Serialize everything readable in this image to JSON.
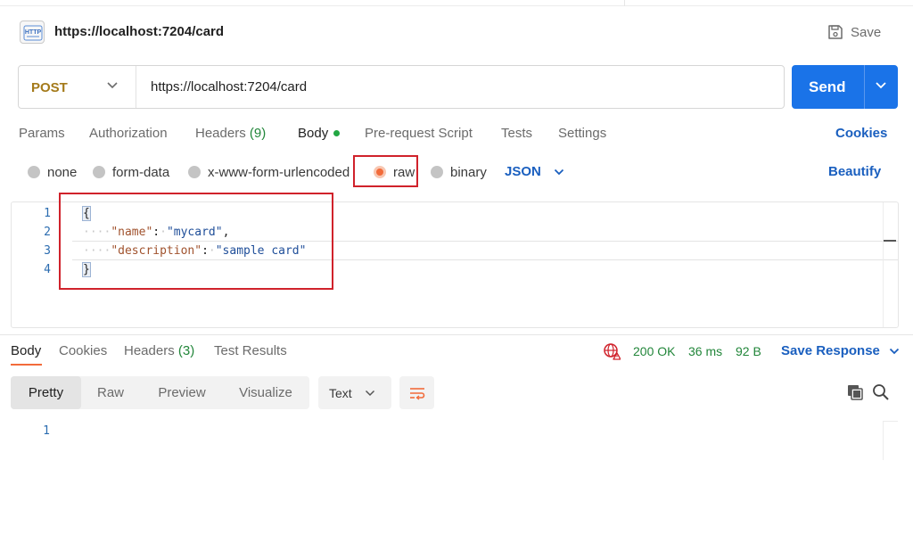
{
  "header": {
    "tab_title": "https://localhost:7204/card",
    "http_icon": "http-file-icon",
    "save_label": "Save"
  },
  "request": {
    "method": "POST",
    "url": "https://localhost:7204/card",
    "send_label": "Send"
  },
  "request_tabs": {
    "params": "Params",
    "authorization": "Authorization",
    "headers": "Headers",
    "headers_count": "(9)",
    "body": "Body",
    "prerequest": "Pre-request Script",
    "tests": "Tests",
    "settings": "Settings",
    "cookies": "Cookies"
  },
  "body_types": {
    "none": "none",
    "form_data": "form-data",
    "urlencoded": "x-www-form-urlencoded",
    "raw": "raw",
    "binary": "binary",
    "selected": "raw",
    "format": "JSON",
    "beautify": "Beautify"
  },
  "editor": {
    "line_numbers": [
      "1",
      "2",
      "3",
      "4"
    ],
    "open_brace": "{",
    "close_brace": "}",
    "indent": "····",
    "key1": "\"name\"",
    "value1": "\"mycard\"",
    "key2": "\"description\"",
    "value2": "\"sample card\""
  },
  "response_tabs": {
    "body": "Body",
    "cookies": "Cookies",
    "headers": "Headers",
    "headers_count": "(3)",
    "test_results": "Test Results"
  },
  "response_status": {
    "status": "200 OK",
    "time": "36 ms",
    "size": "92 B",
    "save_response": "Save Response"
  },
  "response_view": {
    "pretty": "Pretty",
    "raw": "Raw",
    "preview": "Preview",
    "visualize": "Visualize",
    "format": "Text",
    "line_number": "1"
  },
  "colors": {
    "accent_blue": "#1a73e8",
    "link_blue": "#1a5fbf",
    "method_color": "#a47a1a",
    "success_green": "#22863a",
    "annotation_red": "#d0222b",
    "radio_selected": "#f26b3a"
  }
}
